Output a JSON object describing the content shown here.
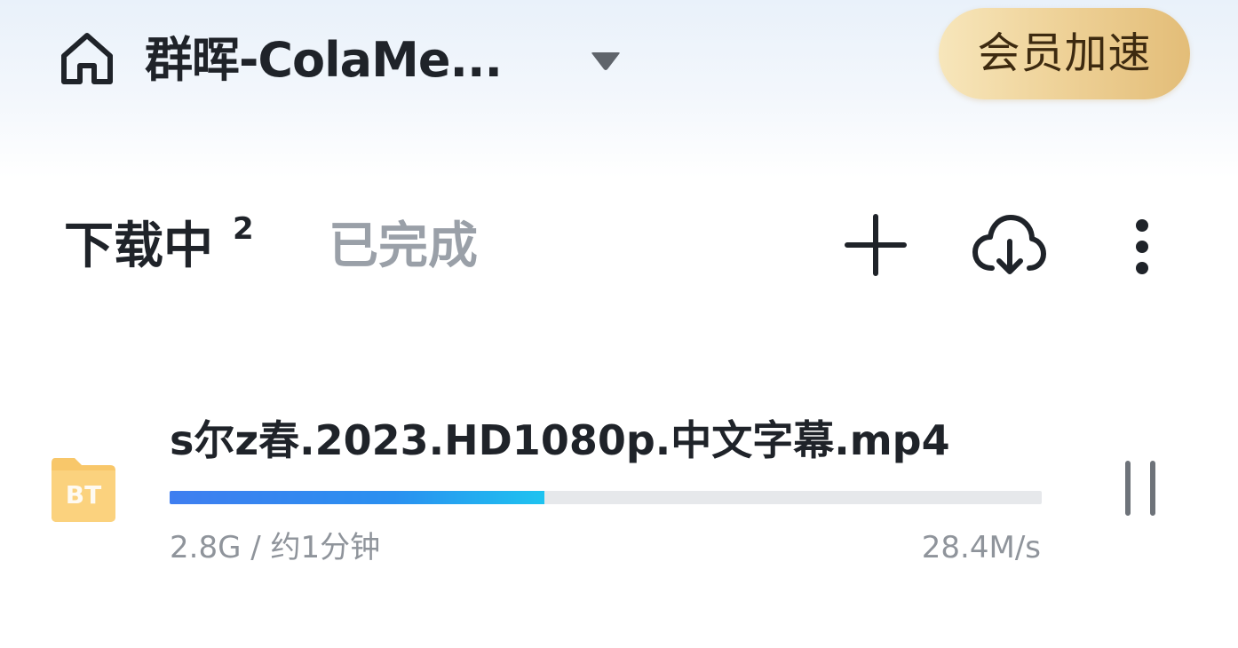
{
  "header": {
    "home_icon": "home-icon",
    "title": "群晖-ColaMe...",
    "dropdown_icon": "dropdown-triangle-icon",
    "vip_button_label": "会员加速",
    "vip_colors": [
      "#f7e6bb",
      "#e3bd78"
    ]
  },
  "tabs": [
    {
      "label": "下载中",
      "count": "2",
      "active": true
    },
    {
      "label": "已完成",
      "active": false
    }
  ],
  "toolbar": {
    "icons": [
      "add-icon",
      "cloud-download-icon",
      "more-icon"
    ]
  },
  "tasks": [
    {
      "type_icon": "BT",
      "name": "s尔z春.2023.HD1080p.中文字幕.mp4",
      "progress": 0.43,
      "size_eta": "2.8G / 约1分钟",
      "speed": "28.4M/s",
      "action_icon": "pause-icon"
    }
  ],
  "colors": {
    "accent": "#3f7ef0",
    "accent_end": "#1ec3f0",
    "inactive_tab": "#9aa0a8",
    "secondary_text": "#8f949b"
  }
}
